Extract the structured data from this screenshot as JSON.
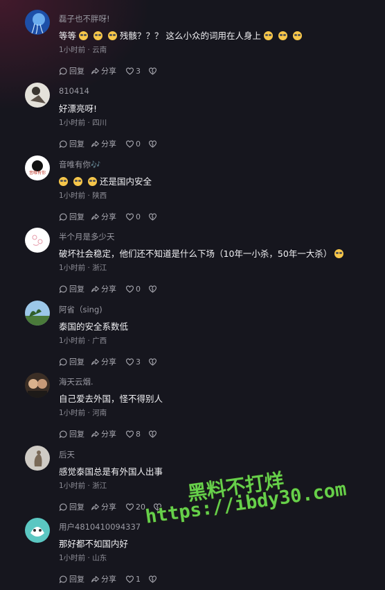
{
  "comments": [
    {
      "user": "磊子也不胖呀!",
      "text_parts": [
        "等等",
        "",
        "",
        "残骸？？？ 这么小众的词用在人身上",
        "",
        ""
      ],
      "meta": "1小时前 · 云南",
      "reply": "回复",
      "share": "分享",
      "likes": "3"
    },
    {
      "user": "810414",
      "text": "好漂亮呀!",
      "meta": "1小时前 · 四川",
      "reply": "回复",
      "share": "分享",
      "likes": "0"
    },
    {
      "user": "音唯有你🎶",
      "text": "还是国内安全",
      "meta": "1小时前 · 陕西",
      "reply": "回复",
      "share": "分享",
      "likes": "0"
    },
    {
      "user": "半个月是多少天",
      "text": "破坏社会稳定，他们还不知道是什么下场（10年一小杀，50年一大杀）",
      "meta": "1小时前 · 浙江",
      "reply": "回复",
      "share": "分享",
      "likes": "0"
    },
    {
      "user": "阿省（sing)",
      "text": "泰国的安全系数低",
      "meta": "1小时前 · 广西",
      "reply": "回复",
      "share": "分享",
      "likes": "3"
    },
    {
      "user": "海天云烟.",
      "text": "自己爱去外国，怪不得别人",
      "meta": "1小时前 · 河南",
      "reply": "回复",
      "share": "分享",
      "likes": "8"
    },
    {
      "user": "后天",
      "text": "感觉泰国总是有外国人出事",
      "meta": "1小时前 · 浙江",
      "reply": "回复",
      "share": "分享",
      "likes": "20"
    },
    {
      "user": "用户4810410094337",
      "text": "那好都不如国内好",
      "meta": "1小时前 · 山东",
      "reply": "回复",
      "share": "分享",
      "likes": "1"
    }
  ],
  "avatar3_text": "音唯有你",
  "watermark": {
    "line1": "黑料不打烊",
    "line2": "https://ibdy30.com"
  }
}
